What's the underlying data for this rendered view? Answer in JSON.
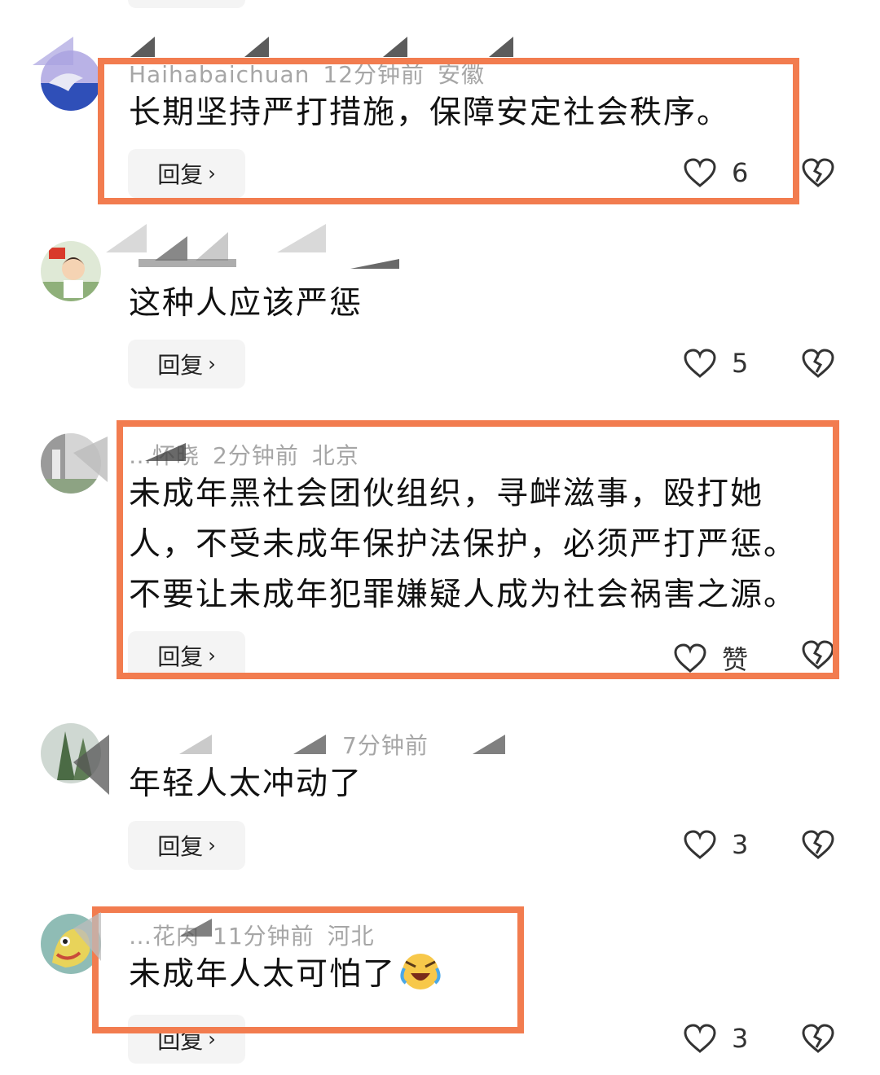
{
  "reply_label": "回复",
  "reply_chevron": "›",
  "icons": {
    "like": "heart-outline-icon",
    "dislike": "broken-heart-icon",
    "emoji": "laughing-crying-emoji"
  },
  "colors": {
    "highlight": "#f27c4f",
    "meta_text": "#a6a6a6",
    "reply_bg": "#f4f4f4"
  },
  "comments": [
    {
      "username": "Haihabaichuan",
      "time": "12分钟前",
      "location": "安徽",
      "text": "长期坚持严打措施，保障安定社会秩序。",
      "likes": "6",
      "highlighted": true
    },
    {
      "username": "",
      "time": "",
      "location": "",
      "text": "这种人应该严惩",
      "likes": "5",
      "highlighted": false
    },
    {
      "username": "…怀晓",
      "time": "2分钟前",
      "location": "北京",
      "text": "未成年黑社会团伙组织，寻衅滋事，殴打她人，不受未成年保护法保护，必须严打严惩。不要让未成年犯罪嫌疑人成为社会祸害之源。",
      "likes": "赞",
      "highlighted": true
    },
    {
      "username": "",
      "time": "7分钟前",
      "location": "",
      "text": "年轻人太冲动了",
      "likes": "3",
      "highlighted": false
    },
    {
      "username": "…花肉",
      "time": "11分钟前",
      "location": "河北",
      "text": "未成年人太可怕了",
      "likes": "3",
      "highlighted": true
    }
  ]
}
